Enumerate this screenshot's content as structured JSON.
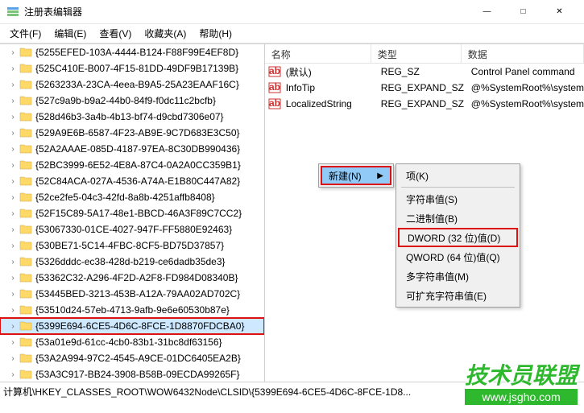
{
  "window": {
    "title": "注册表编辑器",
    "min": "—",
    "max": "□",
    "close": "✕"
  },
  "menu": {
    "file": "文件(F)",
    "edit": "编辑(E)",
    "view": "查看(V)",
    "favorites": "收藏夹(A)",
    "help": "帮助(H)"
  },
  "tree": {
    "items": [
      "{5255EFED-103A-4444-B124-F88F99E4EF8D}",
      "{525C410E-B007-4F15-81DD-49DF9B17139B}",
      "{5263233A-23CA-4eea-B9A5-25A23EAAF16C}",
      "{527c9a9b-b9a2-44b0-84f9-f0dc11c2bcfb}",
      "{528d46b3-3a4b-4b13-bf74-d9cbd7306e07}",
      "{529A9E6B-6587-4F23-AB9E-9C7D683E3C50}",
      "{52A2AAAE-085D-4187-97EA-8C30DB990436}",
      "{52BC3999-6E52-4E8A-87C4-0A2A0CC359B1}",
      "{52C84ACA-027A-4536-A74A-E1B80C447A82}",
      "{52ce2fe5-04c3-42fd-8a8b-4251affb8408}",
      "{52F15C89-5A17-48e1-BBCD-46A3F89C7CC2}",
      "{53067330-01CE-4027-947F-FF5880E92463}",
      "{530BE71-5C14-4FBC-8CF5-BD75D37857}",
      "{5326dddc-ec38-428d-b219-ce6dadb35de3}",
      "{53362C32-A296-4F2D-A2F8-FD984D08340B}",
      "{53445BED-3213-453B-A12A-79AA02AD702C}",
      "{53510d24-57eb-4713-9afb-9e6e60530b87e}",
      "{5399E694-6CE5-4D6C-8FCE-1D8870FDCBA0}",
      "{53a01e9d-61cc-4cb0-83b1-31bc8df63156}",
      "{53A2A994-97C2-4545-A9CE-01DC6405EA2B}",
      "{53A3C917-BB24-3908-B58B-09ECDA99265F}"
    ],
    "selected_index": 17
  },
  "list": {
    "headers": {
      "name": "名称",
      "type": "类型",
      "data": "数据"
    },
    "rows": [
      {
        "name": "(默认)",
        "type": "REG_SZ",
        "data": "Control Panel command"
      },
      {
        "name": "InfoTip",
        "type": "REG_EXPAND_SZ",
        "data": "@%SystemRoot%\\system"
      },
      {
        "name": "LocalizedString",
        "type": "REG_EXPAND_SZ",
        "data": "@%SystemRoot%\\system"
      }
    ]
  },
  "context_menu": {
    "new": "新建(N)",
    "items": [
      "项(K)",
      "字符串值(S)",
      "二进制值(B)",
      "DWORD (32 位)值(D)",
      "QWORD (64 位)值(Q)",
      "多字符串值(M)",
      "可扩充字符串值(E)"
    ],
    "highlighted_index": 3
  },
  "statusbar": {
    "path": "计算机\\HKEY_CLASSES_ROOT\\WOW6432Node\\CLSID\\{5399E694-6CE5-4D6C-8FCE-1D8..."
  },
  "watermark": {
    "text": "技术员联盟",
    "url": "www.jsgho.com"
  }
}
